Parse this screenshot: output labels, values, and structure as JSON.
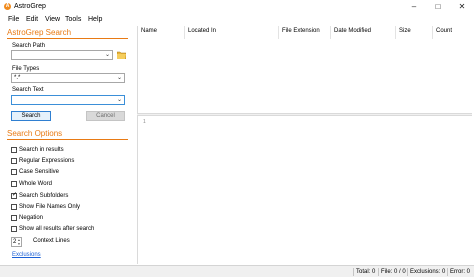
{
  "window": {
    "title": "AstroGrep",
    "app_icon": "astrogrep-icon",
    "controls": [
      "minimize-icon",
      "maximize-icon",
      "close-icon"
    ]
  },
  "menu": [
    "File",
    "Edit",
    "View",
    "Tools",
    "Help"
  ],
  "search": {
    "header": "AstroGrep Search",
    "path_label": "Search Path",
    "path_value": "",
    "file_types_label": "File Types",
    "file_types_value": "*.*",
    "text_label": "Search Text",
    "text_value": "",
    "search_button": "Search",
    "cancel_button": "Cancel"
  },
  "options": {
    "header": "Search Options",
    "items": [
      {
        "label": "Search in results",
        "checked": false
      },
      {
        "label": "Regular Expressions",
        "checked": false
      },
      {
        "label": "Case Sensitive",
        "checked": false
      },
      {
        "label": "Whole Word",
        "checked": false
      },
      {
        "label": "Search Subfolders",
        "checked": true
      },
      {
        "label": "Show File Names Only",
        "checked": false
      },
      {
        "label": "Negation",
        "checked": false
      },
      {
        "label": "Show all results after search",
        "checked": false
      }
    ],
    "context_lines_value": "2",
    "context_lines_label": "Context Lines",
    "exclusions_link": "Exclusions"
  },
  "results": {
    "columns": [
      "Name",
      "Located In",
      "File Extension",
      "Date Modified",
      "Size",
      "Count"
    ]
  },
  "preview": {
    "line_number": "1"
  },
  "status": {
    "total": "Total: 0",
    "file": "File: 0 / 0",
    "exclusions": "Exclusions: 0",
    "error": "Error: 0"
  },
  "colors": {
    "accent": "#e87a14",
    "link": "#1a5fd6",
    "focus": "#3b8fd8"
  }
}
